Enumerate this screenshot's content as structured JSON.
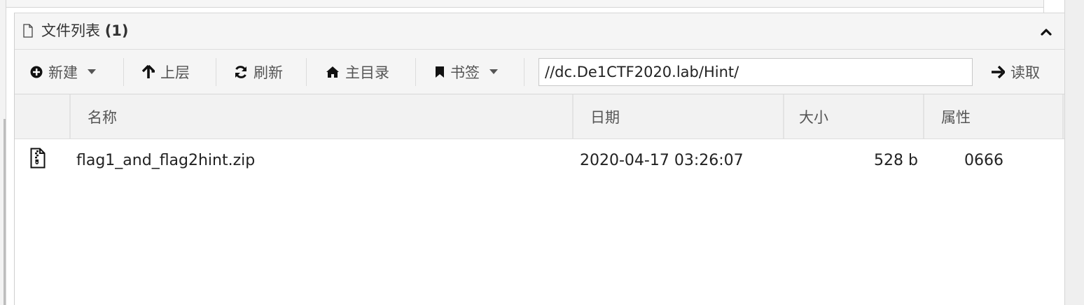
{
  "panel": {
    "title": "文件列表",
    "count": "(1)"
  },
  "toolbar": {
    "new_label": "新建",
    "up_label": "上层",
    "refresh_label": "刷新",
    "home_label": "主目录",
    "bookmark_label": "书签",
    "path_value": "//dc.De1CTF2020.lab/Hint/",
    "read_label": "读取"
  },
  "table": {
    "columns": [
      "名称",
      "日期",
      "大小",
      "属性"
    ],
    "rows": [
      {
        "icon": "zip-file-icon",
        "name": "flag1_and_flag2hint.zip",
        "date": "2020-04-17 03:26:07",
        "size": "528 b",
        "attr": "0666"
      }
    ]
  }
}
